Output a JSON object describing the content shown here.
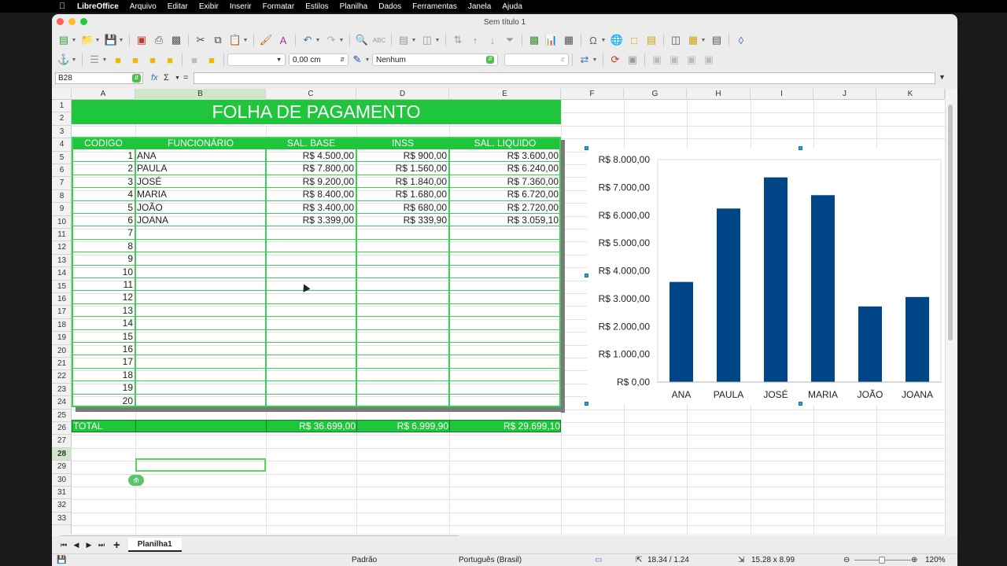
{
  "menubar": {
    "app": "LibreOffice",
    "items": [
      "Arquivo",
      "Editar",
      "Exibir",
      "Inserir",
      "Formatar",
      "Estilos",
      "Planilha",
      "Dados",
      "Ferramentas",
      "Janela",
      "Ajuda"
    ]
  },
  "window": {
    "title": "Sem título 1"
  },
  "toolbar2": {
    "line_width": "0,00 cm",
    "area_fill": "Nenhum"
  },
  "formula_bar": {
    "name_box": "B28",
    "fx": "fx",
    "sigma": "Σ",
    "equals": "="
  },
  "columns": [
    "A",
    "B",
    "C",
    "D",
    "E",
    "F",
    "G",
    "H",
    "I",
    "J",
    "K"
  ],
  "rows": [
    "1",
    "2",
    "3",
    "4",
    "5",
    "6",
    "7",
    "8",
    "9",
    "10",
    "11",
    "12",
    "13",
    "14",
    "15",
    "16",
    "17",
    "18",
    "19",
    "20",
    "21",
    "22",
    "23",
    "24",
    "25",
    "26",
    "27",
    "28",
    "29",
    "30",
    "31",
    "32",
    "33"
  ],
  "sheet": {
    "title": "FOLHA DE PAGAMENTO",
    "headers": [
      "CODIGO",
      "FUNCIONÁRIO",
      "SAL. BASE",
      "INSS",
      "SAL. LIQUIDO"
    ],
    "employees": [
      {
        "code": "1",
        "name": "ANA",
        "base": "R$ 4.500,00",
        "inss": "R$ 900,00",
        "liquid": "R$ 3.600,00"
      },
      {
        "code": "2",
        "name": "PAULA",
        "base": "R$ 7.800,00",
        "inss": "R$ 1.560,00",
        "liquid": "R$ 6.240,00"
      },
      {
        "code": "3",
        "name": "JOSÉ",
        "base": "R$ 9.200,00",
        "inss": "R$ 1.840,00",
        "liquid": "R$ 7.360,00"
      },
      {
        "code": "4",
        "name": "MARIA",
        "base": "R$ 8.400,00",
        "inss": "R$ 1.680,00",
        "liquid": "R$ 6.720,00"
      },
      {
        "code": "5",
        "name": "JOÃO",
        "base": "R$ 3.400,00",
        "inss": "R$ 680,00",
        "liquid": "R$ 2.720,00"
      },
      {
        "code": "6",
        "name": "JOANA",
        "base": "R$ 3.399,00",
        "inss": "R$ 339,90",
        "liquid": "R$ 3.059,10"
      }
    ],
    "empty_codes": [
      "7",
      "8",
      "9",
      "10",
      "11",
      "12",
      "13",
      "14",
      "15",
      "16",
      "17",
      "18",
      "19",
      "20"
    ],
    "total": {
      "label": "TOTAL",
      "base": "R$ 36.699,00",
      "inss": "R$ 6.999,90",
      "liquid": "R$ 29.699,10"
    }
  },
  "chart_data": {
    "type": "bar",
    "categories": [
      "ANA",
      "PAULA",
      "JOSÉ",
      "MARIA",
      "JOÃO",
      "JOANA"
    ],
    "values": [
      3600,
      6240,
      7360,
      6720,
      2720,
      3059.1
    ],
    "ylim": [
      0,
      8000
    ],
    "yticks": [
      0,
      1000,
      2000,
      3000,
      4000,
      5000,
      6000,
      7000,
      8000
    ],
    "ytick_labels": [
      "R$ 0,00",
      "R$ 1.000,00",
      "R$ 2.000,00",
      "R$ 3.000,00",
      "R$ 4.000,00",
      "R$ 5.000,00",
      "R$ 6.000,00",
      "R$ 7.000,00",
      "R$ 8.000,00"
    ],
    "bar_color": "#004586",
    "grid": false,
    "legend": false
  },
  "sheet_tabs": {
    "active": "Planilha1",
    "add": "+"
  },
  "statusbar": {
    "style": "Padrão",
    "language": "Português (Brasil)",
    "position": "18.34 / 1.24",
    "size": "15.28 x 8.99",
    "zoom": "120%"
  },
  "colors": {
    "accent_green": "#1fc63c",
    "border_green": "#3bcf56",
    "selection_green": "#5bd463"
  }
}
